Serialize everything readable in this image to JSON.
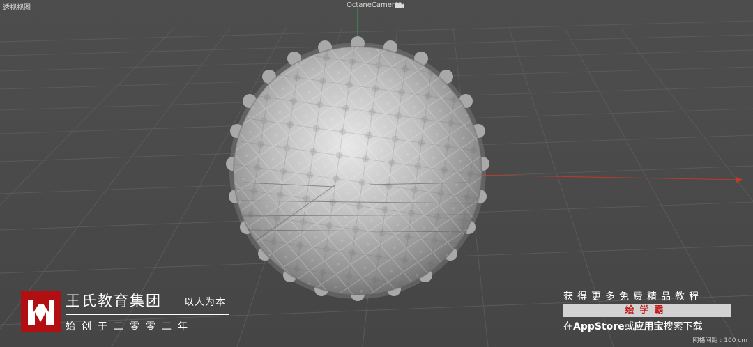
{
  "viewport": {
    "view_name": "透视视图",
    "camera_name": "OctaneCamera",
    "camera_icon": "camera-icon",
    "grid_spacing": "网格间距 : 100 cm",
    "background": "#4b4b4b",
    "axis_colors": {
      "x": "#c0392b",
      "y": "#27ae60"
    }
  },
  "watermark_left": {
    "logo_icon": "w-logo-icon",
    "logo_color": "#b10f12",
    "brand_name": "王氏教育集团",
    "slogan": "以人为本",
    "tagline": "始创于二零零二年"
  },
  "watermark_right": {
    "line1": "获得更多免费精品教程",
    "app_name": "绘学霸",
    "line3_prefix": "在",
    "line3_store": "AppStore",
    "line3_or": "或",
    "line3_store2": "应用宝",
    "line3_suffix": "搜索下载"
  }
}
